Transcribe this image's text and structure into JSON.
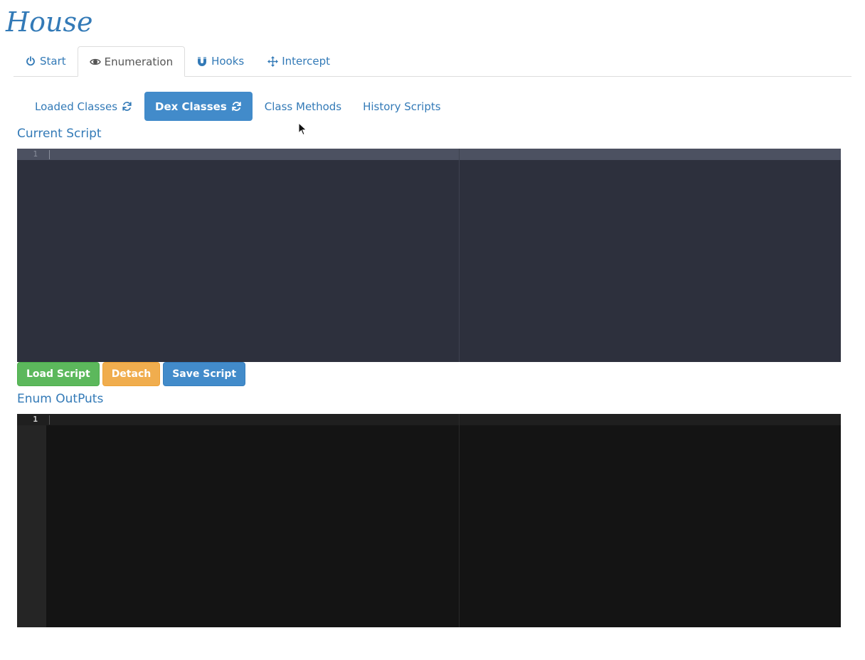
{
  "app": {
    "title": "House"
  },
  "main_tabs": [
    {
      "label": "Start",
      "icon": "power-icon"
    },
    {
      "label": "Enumeration",
      "icon": "eye-icon"
    },
    {
      "label": "Hooks",
      "icon": "magnet-icon"
    },
    {
      "label": "Intercept",
      "icon": "move-icon"
    }
  ],
  "main_tabs_active": "Enumeration",
  "sub_tabs": [
    {
      "label": "Loaded Classes",
      "icon": "refresh-icon"
    },
    {
      "label": "Dex Classes",
      "icon": "refresh-icon"
    },
    {
      "label": "Class Methods"
    },
    {
      "label": "History Scripts"
    }
  ],
  "sub_tabs_active": "Dex Classes",
  "script_section": {
    "label": "Current Script",
    "line_number": "1",
    "content": ""
  },
  "buttons": {
    "load_script": "Load Script",
    "detach": "Detach",
    "save_script": "Save Script"
  },
  "output_section": {
    "label": "Enum OutPuts",
    "line_number": "1",
    "content": ""
  },
  "colors": {
    "link": "#337ab7",
    "primary": "#428bca",
    "success": "#5cb85c",
    "warning": "#f0ad4e",
    "script_editor_bg": "#2d303d",
    "output_editor_bg": "#141414"
  }
}
